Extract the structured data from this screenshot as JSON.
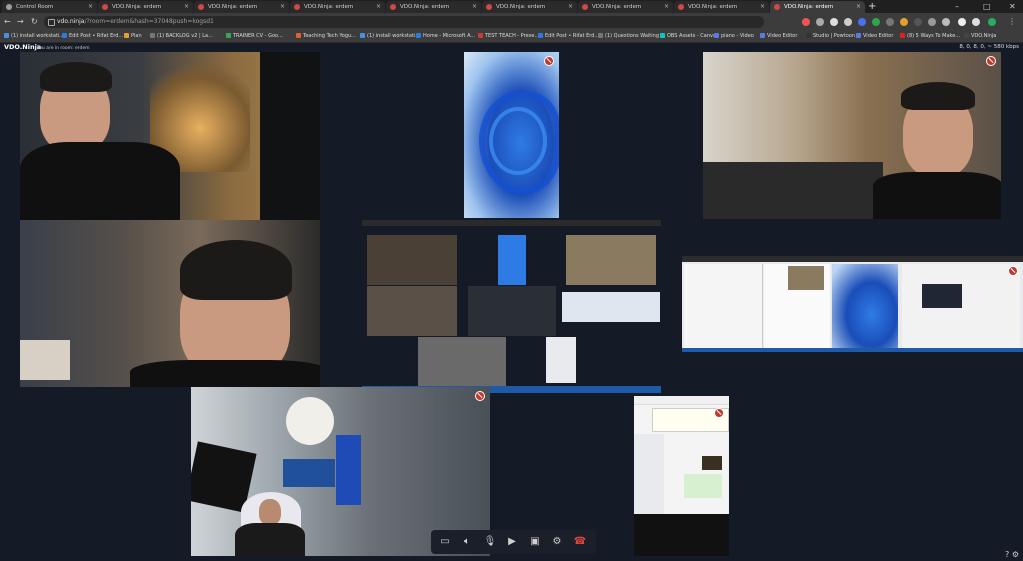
{
  "browser": {
    "tabs": [
      {
        "label": "Control Room",
        "favicon": "chrome-icon"
      },
      {
        "label": "VDO.Ninja: erdem",
        "favicon": "vdo-icon"
      },
      {
        "label": "VDO.Ninja: erdem",
        "favicon": "vdo-icon"
      },
      {
        "label": "VDO.Ninja: erdem",
        "favicon": "vdo-icon"
      },
      {
        "label": "VDO.Ninja: erdem",
        "favicon": "vdo-icon"
      },
      {
        "label": "VDO.Ninja: erdem",
        "favicon": "vdo-icon"
      },
      {
        "label": "VDO.Ninja: erdem",
        "favicon": "vdo-icon"
      },
      {
        "label": "VDO.Ninja: erdem",
        "favicon": "vdo-icon"
      },
      {
        "label": "VDO.Ninja: erdem",
        "favicon": "vdo-icon",
        "active": true
      }
    ],
    "url_host": "vdo.ninja",
    "url_path": "/?room=erdem&hash=37048push=kogsd1",
    "bookmarks": [
      "(1) install workstati...",
      "Edit Post • Rifat Erd...",
      "Plan",
      "(1) BACKLOG v2 | La...",
      "TRAINER CV - Goo...",
      "Teaching Tech Yogu...",
      "(1) install workstati...",
      "Home - Microsoft A...",
      "TEST TEACH - Prese...",
      "Edit Post • Rifat Erd...",
      "(1) Questions Waiting",
      "OBS Assets - Canva",
      "piano - Video",
      "Video Editor",
      "Studio | Powtoon",
      "Video Editor",
      "(8) 5 Ways To Make...",
      "VDO.Ninja"
    ]
  },
  "app": {
    "brand": "VDO.Ninja",
    "subtitle": "You are in room: erdem",
    "stats": "8,  0,  8,  0,  ~ 580 kbps"
  },
  "controls": {
    "chat": "chat-icon",
    "speaker": "speaker-icon",
    "mic": "microphone-icon",
    "camera": "camera-icon",
    "screenshare": "screen-share-icon",
    "settings": "gear-icon",
    "hangup": "hangup-icon"
  },
  "colors": {
    "background": "#141a26",
    "mute_badge": "#c0392b",
    "hangup": "#e0463b"
  }
}
